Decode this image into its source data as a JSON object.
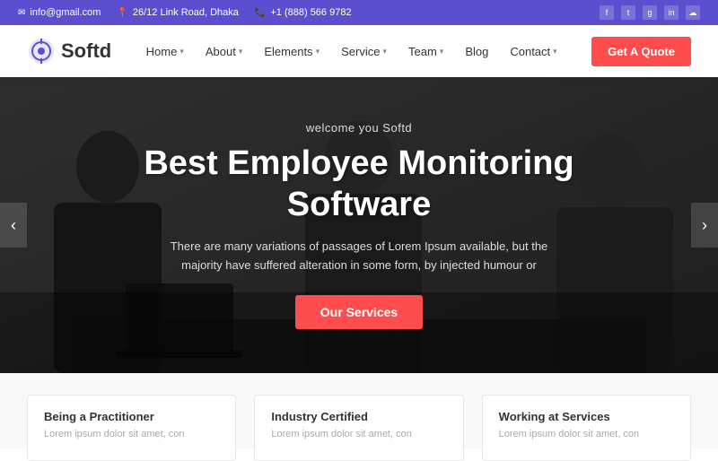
{
  "topbar": {
    "email": "info@gmail.com",
    "address": "26/12 Link Road, Dhaka",
    "phone": "+1 (888) 566 9782",
    "socials": [
      "f",
      "t",
      "g+",
      "in",
      "☁"
    ]
  },
  "navbar": {
    "logo_text": "Softd",
    "nav_items": [
      {
        "label": "Home",
        "has_caret": true
      },
      {
        "label": "About",
        "has_caret": true
      },
      {
        "label": "Elements",
        "has_caret": true
      },
      {
        "label": "Service",
        "has_caret": true
      },
      {
        "label": "Team",
        "has_caret": true
      },
      {
        "label": "Blog",
        "has_caret": false
      },
      {
        "label": "Contact",
        "has_caret": true
      }
    ],
    "cta_label": "Get A Quote"
  },
  "hero": {
    "subtitle": "welcome you Softd",
    "title_line1": "Best Employee Monitoring",
    "title_line2": "Software",
    "description": "There are many variations of passages of Lorem Ipsum available, but the majority have suffered alteration in some form, by injected humour or",
    "cta_label": "Our Services",
    "arrow_left": "‹",
    "arrow_right": "›"
  },
  "features": [
    {
      "title": "Being a Practitioner",
      "text": "Lorem ipsum dolor sit amet, con"
    },
    {
      "title": "Industry Certified",
      "text": "Lorem ipsum dolor sit amet, con"
    },
    {
      "title": "Working at Services",
      "text": "Lorem ipsum dolor sit amet, con"
    }
  ]
}
